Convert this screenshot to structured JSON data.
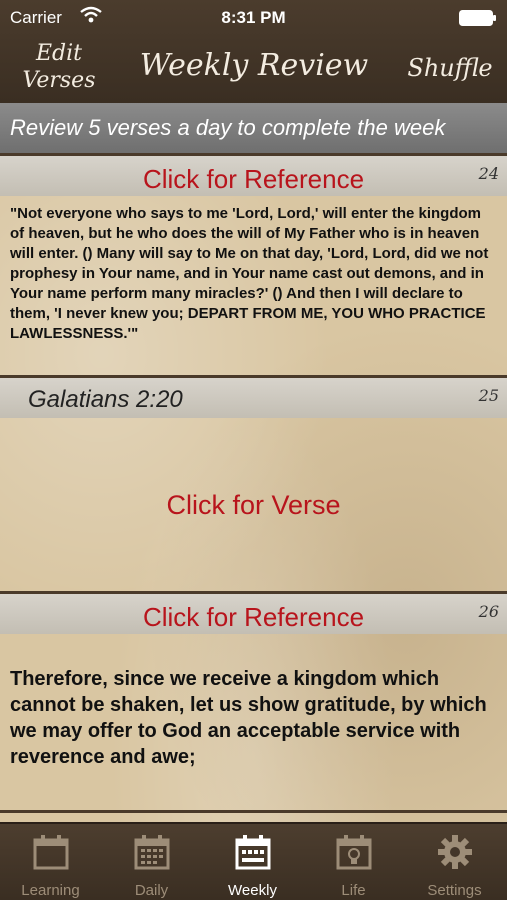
{
  "status": {
    "carrier": "Carrier",
    "time": "8:31 PM"
  },
  "nav": {
    "edit_line1": "Edit",
    "edit_line2": "Verses",
    "title": "Weekly Review",
    "shuffle": "Shuffle"
  },
  "banner": "Review 5 verses a day to complete the week",
  "cards": [
    {
      "reference": "Click for Reference",
      "number": "24",
      "text": "\"Not everyone who says to me 'Lord, Lord,' will enter the kingdom of heaven, but he who does the will of My Father who is in heaven will enter. () Many will say to Me on that day, 'Lord, Lord, did we not prophesy in Your name, and in Your name cast out demons, and in Your name perform many miracles?' () And then I will declare to them, 'I never knew you; DEPART FROM ME, YOU WHO PRACTICE LAWLESSNESS.'\""
    },
    {
      "reference": "Galatians 2:20",
      "number": "25",
      "text": "Click for Verse"
    },
    {
      "reference": "Click for Reference",
      "number": "26",
      "text": "Therefore, since we receive a kingdom which cannot be shaken, let us show gratitude, by which we may offer to God an acceptable service with reverence and awe;"
    }
  ],
  "tabs": [
    {
      "label": "Learning",
      "icon": "calendar-icon"
    },
    {
      "label": "Daily",
      "icon": "calendar-grid-icon"
    },
    {
      "label": "Weekly",
      "icon": "calendar-week-icon",
      "active": true
    },
    {
      "label": "Life",
      "icon": "lightbulb-calendar-icon"
    },
    {
      "label": "Settings",
      "icon": "gear-icon"
    }
  ],
  "colors": {
    "header": "#3f3226",
    "accent_red": "#b8141c",
    "banner": "#7c7c7c",
    "paper": "#d9c6a2"
  }
}
